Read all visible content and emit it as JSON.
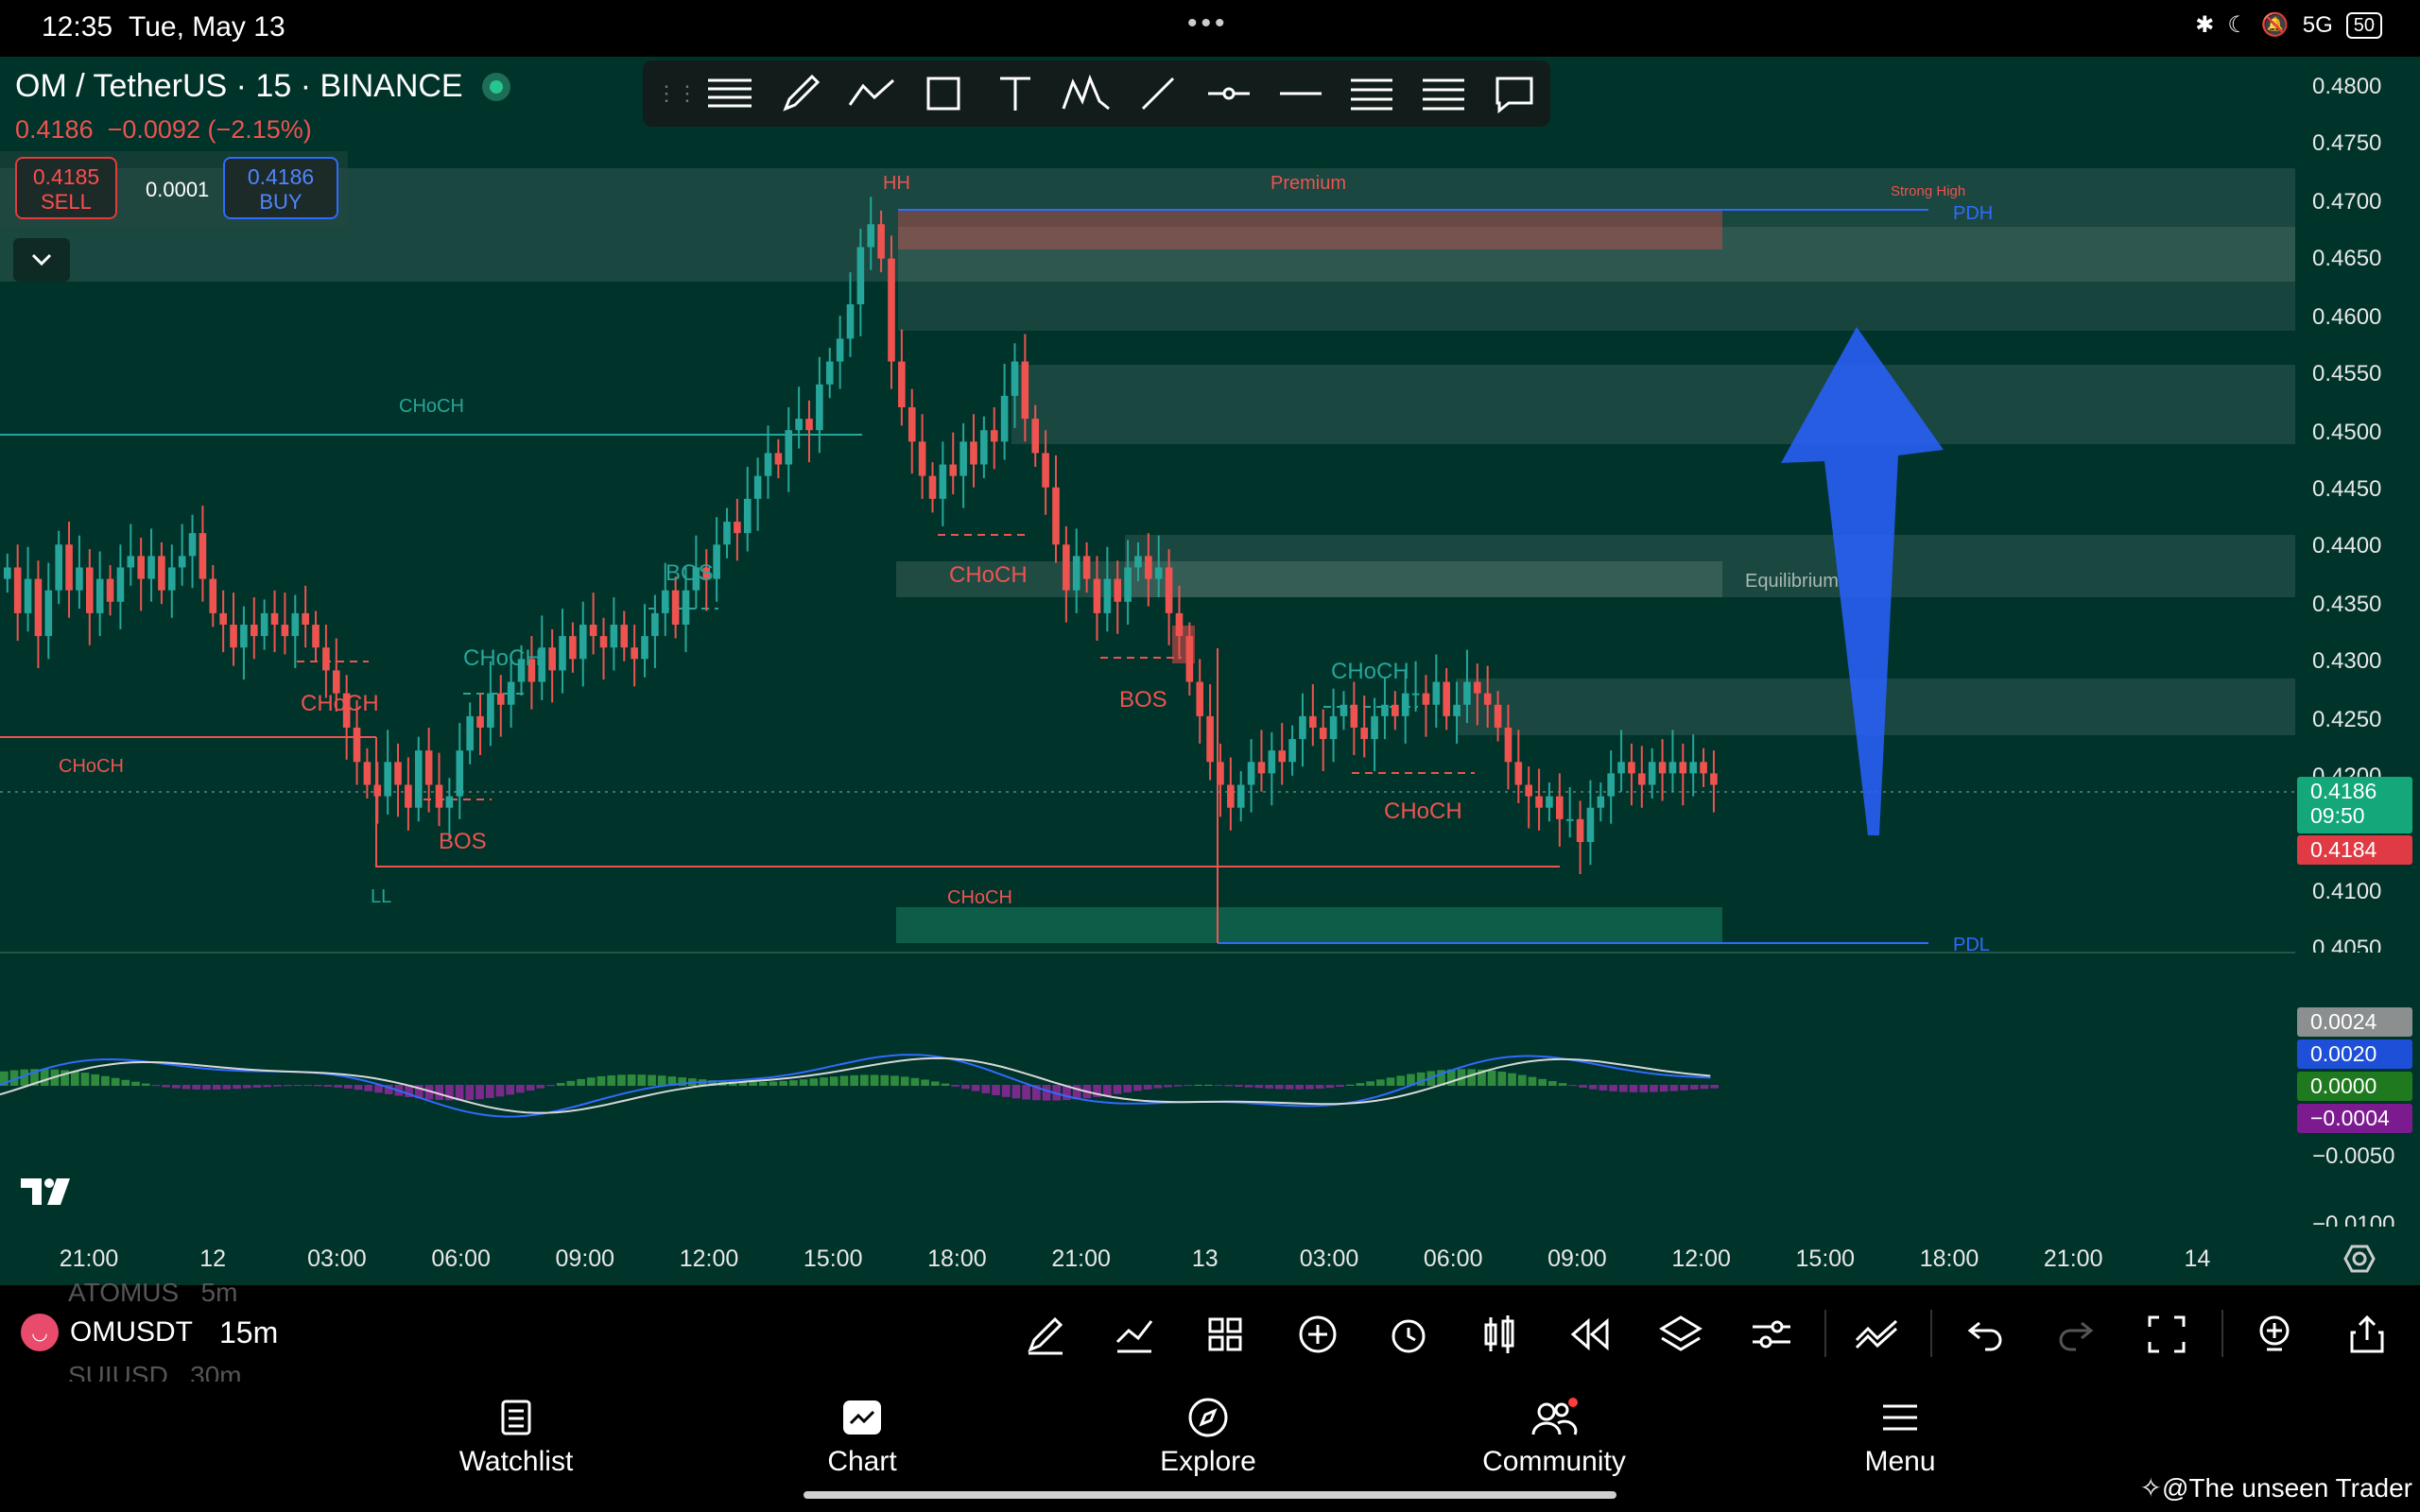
{
  "status": {
    "time": "12:35",
    "date": "Tue, May 13",
    "battery": "50",
    "signal": "5G"
  },
  "symbol": {
    "title": "OM / TetherUS · 15 · BINANCE",
    "last": "0.4186",
    "change": "−0.0092 (−2.15%)"
  },
  "trade": {
    "sell_price": "0.4185",
    "sell_label": "SELL",
    "spread": "0.0001",
    "buy_price": "0.4186",
    "buy_label": "BUY"
  },
  "drawing_tools": [
    "lines-icon",
    "brush-icon",
    "path-icon",
    "rectangle-icon",
    "text-icon",
    "pattern-icon",
    "trend-line-icon",
    "horizontal-ray-icon",
    "horizontal-line-icon",
    "fib-icon",
    "fib-ext-icon",
    "comment-icon"
  ],
  "price_axis": [
    "0.4800",
    "0.4750",
    "0.4700",
    "0.4650",
    "0.4600",
    "0.4550",
    "0.4500",
    "0.4450",
    "0.4400",
    "0.4350",
    "0.4300",
    "0.4250",
    "0.4200",
    "0.4100",
    "0.4050"
  ],
  "price_tags": {
    "last_price": "0.4186",
    "countdown": "09:50",
    "bid": "0.4184"
  },
  "macd_axis": {
    "macd": "0.0024",
    "signal": "0.0020",
    "zero": "0.0000",
    "hist": "−0.0004",
    "low": "−0.0050",
    "lower": "−0.0100"
  },
  "time_axis": [
    "21:00",
    "12",
    "03:00",
    "06:00",
    "09:00",
    "12:00",
    "15:00",
    "18:00",
    "21:00",
    "13",
    "03:00",
    "06:00",
    "09:00",
    "12:00",
    "15:00",
    "18:00",
    "21:00",
    "14"
  ],
  "annotations": {
    "choch": "CHoCH",
    "bos": "BOS",
    "hh": "HH",
    "ll": "LL",
    "premium": "Premium",
    "strong_high": "Strong High",
    "pdh": "PDH",
    "pdl": "PDL",
    "equilibrium": "Equilibrium"
  },
  "watchlist_ghost": {
    "above_symbol": "ATOMUS",
    "above_interval": "5m",
    "below_symbol": "SUIUSD",
    "below_interval": "30m"
  },
  "current": {
    "symbol": "OMUSDT",
    "interval": "15m"
  },
  "nav": {
    "watchlist": "Watchlist",
    "chart": "Chart",
    "explore": "Explore",
    "community": "Community",
    "menu": "Menu"
  },
  "watermark": "@The unseen Trader",
  "colors": {
    "bg": "#00332a",
    "up": "#26a69a",
    "down": "#ef5350",
    "arrow": "#2962ff"
  },
  "chart_data": {
    "type": "candlestick",
    "title": "OM / TetherUS · 15 · BINANCE",
    "ylim": [
      0.405,
      0.48
    ],
    "closes": [
      0.438,
      0.434,
      0.437,
      0.432,
      0.436,
      0.44,
      0.436,
      0.438,
      0.434,
      0.437,
      0.435,
      0.438,
      0.439,
      0.437,
      0.439,
      0.436,
      0.438,
      0.439,
      0.441,
      0.437,
      0.434,
      0.433,
      0.431,
      0.433,
      0.432,
      0.434,
      0.433,
      0.432,
      0.434,
      0.433,
      0.431,
      0.429,
      0.427,
      0.424,
      0.421,
      0.419,
      0.418,
      0.421,
      0.419,
      0.417,
      0.422,
      0.419,
      0.417,
      0.418,
      0.422,
      0.425,
      0.424,
      0.427,
      0.426,
      0.428,
      0.43,
      0.428,
      0.431,
      0.429,
      0.432,
      0.43,
      0.433,
      0.432,
      0.431,
      0.433,
      0.431,
      0.43,
      0.432,
      0.434,
      0.436,
      0.433,
      0.436,
      0.438,
      0.437,
      0.44,
      0.442,
      0.441,
      0.444,
      0.446,
      0.448,
      0.447,
      0.45,
      0.451,
      0.45,
      0.454,
      0.456,
      0.458,
      0.461,
      0.466,
      0.468,
      0.465,
      0.456,
      0.452,
      0.449,
      0.446,
      0.444,
      0.447,
      0.446,
      0.449,
      0.447,
      0.45,
      0.449,
      0.453,
      0.456,
      0.451,
      0.448,
      0.445,
      0.44,
      0.436,
      0.439,
      0.437,
      0.434,
      0.437,
      0.435,
      0.438,
      0.439,
      0.437,
      0.438,
      0.434,
      0.432,
      0.428,
      0.425,
      0.421,
      0.419,
      0.417,
      0.419,
      0.421,
      0.42,
      0.422,
      0.421,
      0.423,
      0.425,
      0.424,
      0.423,
      0.425,
      0.426,
      0.424,
      0.423,
      0.425,
      0.426,
      0.425,
      0.427,
      0.427,
      0.426,
      0.428,
      0.425,
      0.426,
      0.428,
      0.427,
      0.426,
      0.424,
      0.421,
      0.419,
      0.418,
      0.417,
      0.418,
      0.416,
      0.416,
      0.414,
      0.417,
      0.418,
      0.42,
      0.421,
      0.42,
      0.419,
      0.421,
      0.42,
      0.421,
      0.42,
      0.421,
      0.42,
      0.419
    ]
  }
}
